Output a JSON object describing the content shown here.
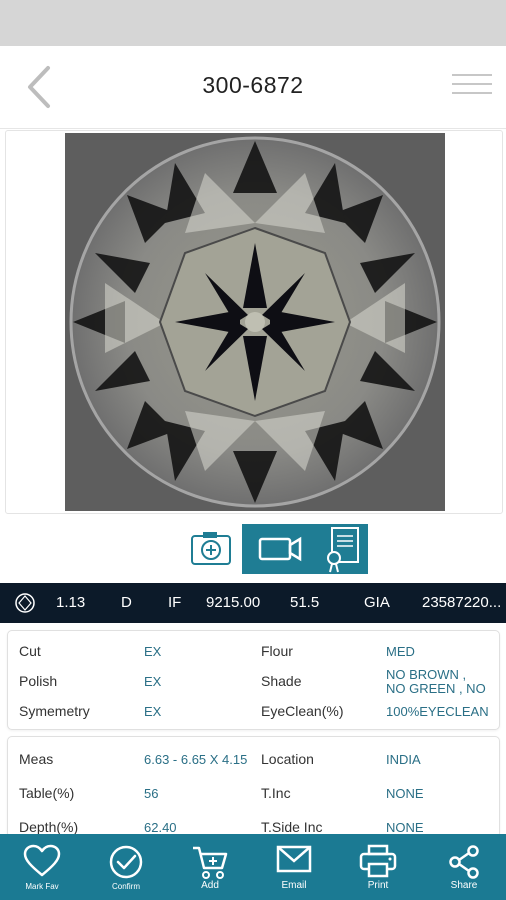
{
  "header": {
    "title": "300-6872"
  },
  "info_bar": {
    "carat": "1.13",
    "color": "D",
    "clarity": "IF",
    "price": "9215.00",
    "discount": "51.5",
    "lab": "GIA",
    "cert_no": "23587220..."
  },
  "details1": {
    "rows": [
      {
        "label": "Cut",
        "value": "EX",
        "label2": "Flour",
        "value2": "MED"
      },
      {
        "label": "Polish",
        "value": "EX",
        "label2": "Shade",
        "value2": "NO BROWN , NO GREEN , NO"
      },
      {
        "label": "Symemetry",
        "value": "EX",
        "label2": "EyeClean(%)",
        "value2": "100%EYECLEAN"
      }
    ]
  },
  "details2": {
    "rows": [
      {
        "label": "Meas",
        "value": "6.63 - 6.65 X 4.15",
        "label2": "Location",
        "value2": "INDIA"
      },
      {
        "label": "Table(%)",
        "value": "56",
        "label2": "T.Inc",
        "value2": "NONE"
      },
      {
        "label": "Depth(%)",
        "value": "62.40",
        "label2": "T.Side Inc",
        "value2": "NONE"
      }
    ]
  },
  "bottom_nav": {
    "items": [
      {
        "label": "Mark Fav",
        "icon": "heart-icon"
      },
      {
        "label": "Confirm",
        "icon": "check-circle-icon"
      },
      {
        "label": "Add",
        "icon": "cart-icon"
      },
      {
        "label": "Email",
        "icon": "mail-icon"
      },
      {
        "label": "Print",
        "icon": "printer-icon"
      },
      {
        "label": "Share",
        "icon": "share-icon"
      }
    ]
  },
  "colors": {
    "teal": "#1f7d94",
    "navy": "#0c1a29",
    "value_text": "#2a6f86"
  }
}
